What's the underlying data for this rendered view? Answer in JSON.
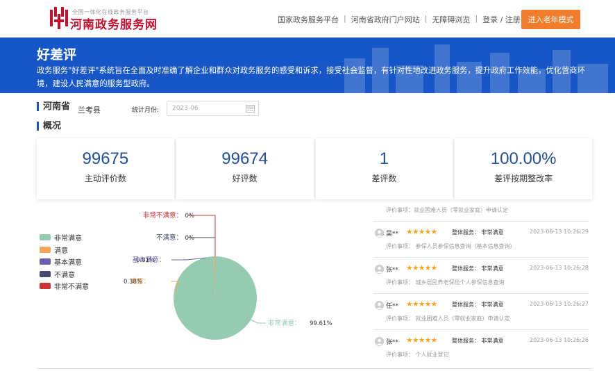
{
  "header": {
    "logo_subtitle": "全国一体化在线政务服务平台",
    "logo_title": "河南政务服务网",
    "nav": [
      {
        "label": "国家政务服务平台"
      },
      {
        "label": "河南省政府门户网站"
      },
      {
        "label": "无障碍浏览"
      },
      {
        "label": "登录 / 注册"
      }
    ],
    "elder_mode_label": "进入老年模式"
  },
  "banner": {
    "title": "好差评",
    "description": "政务服务\"好差评\"系统旨在全面及时准确了解企业和群众对政务服务的感受和诉求，接受社会监督，有针对性地改进政务服务，提升政府工作效能，优化营商环境，建设人民满意的服务型政府。"
  },
  "filter": {
    "province": "河南省",
    "county": "兰考县",
    "month_label": "统计月份:",
    "month_placeholder": "2023-06"
  },
  "overview": {
    "title": "概况",
    "stats": [
      {
        "value": "99675",
        "label": "主动评价数"
      },
      {
        "value": "99674",
        "label": "好评数"
      },
      {
        "value": "1",
        "label": "差评数"
      },
      {
        "value": "100.00%",
        "label": "差评按期整改率"
      }
    ]
  },
  "colors": {
    "brand_blue": "#1756c6",
    "accent_orange": "#f07c2c",
    "stat_number": "#1f4f9e"
  },
  "chart_data": {
    "type": "pie",
    "legend_position": "left",
    "slices": [
      {
        "name": "非常满意",
        "percent": 99.61,
        "label": "99.61%",
        "color": "#95cbb0"
      },
      {
        "name": "满意",
        "percent": 0.38,
        "label": "0.38%",
        "color": "#f5a55a"
      },
      {
        "name": "基本满意",
        "percent": 0.01,
        "label": "0.01%",
        "color": "#6b5fb0"
      },
      {
        "name": "不满意",
        "percent": 0,
        "label": "0%",
        "color": "#464a6e"
      },
      {
        "name": "非常不满意",
        "percent": 0,
        "label": "0%",
        "color": "#cc3333"
      }
    ]
  },
  "reviews": {
    "top_partial_text": "评价事项：就业困难人员（零就业家庭）申请认定",
    "items": [
      {
        "name": "吴**",
        "stars": "★★★★★",
        "overall": "整体服务：  非常满意",
        "time": "2023-06-13 10:26:29",
        "matter": "评价事项：  参保人员参保信息查询（基本信息查询）"
      },
      {
        "name": "张**",
        "stars": "★★★★★",
        "overall": "整体服务：  非常满意",
        "time": "2023-06-13 10:26:28",
        "matter": "评价事项：  城乡居民养老保险个人参保信息查询"
      },
      {
        "name": "任**",
        "stars": "★★★★★",
        "overall": "整体服务：  非常满意",
        "time": "2023-06-13 10:26:27",
        "matter": "评价事项：  就业困难人员（零就业家庭）申请认定"
      },
      {
        "name": "张**",
        "stars": "★★★★★",
        "overall": "整体服务：  非常满意",
        "time": "2023-06-13 10:26:26",
        "matter": "评价事项：  个人就业登记"
      }
    ]
  }
}
